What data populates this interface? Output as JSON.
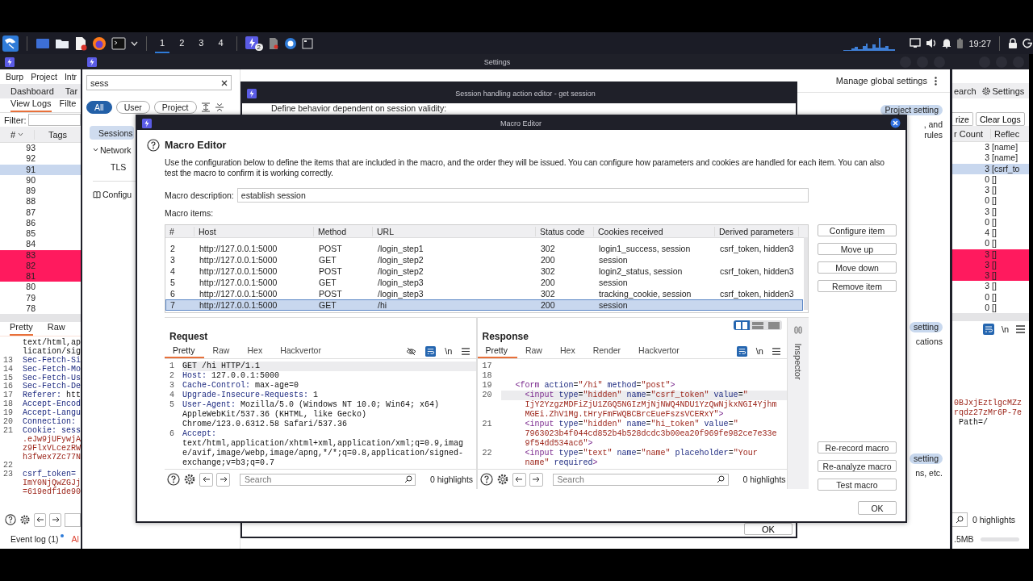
{
  "taskbar": {
    "workspaces": [
      {
        "label": "1",
        "selected": true
      },
      {
        "label": "2",
        "selected": false
      },
      {
        "label": "3",
        "selected": false
      },
      {
        "label": "4",
        "selected": false
      }
    ],
    "app_badge": "2",
    "clock": "19:27"
  },
  "burp_window": {
    "menu": [
      "Burp",
      "Project",
      "Intr"
    ],
    "tabs": [
      "Dashboard",
      "Tar"
    ],
    "subtabs": [
      {
        "label": "View Logs",
        "selected": true
      },
      {
        "label": "Filte",
        "selected": false
      }
    ],
    "filter_label": "Filter:",
    "columns": [
      "#",
      "Tags",
      "r Count",
      "Reflec"
    ],
    "rows": [
      {
        "num": "93",
        "count": "3",
        "reflected": "[name]",
        "selected": false,
        "highlighted": false
      },
      {
        "num": "92",
        "count": "3",
        "reflected": "[name]",
        "selected": false,
        "highlighted": false
      },
      {
        "num": "91",
        "count": "3",
        "reflected": "[csrf_to",
        "selected": true,
        "highlighted": false
      },
      {
        "num": "90",
        "count": "0",
        "reflected": "[]",
        "selected": false,
        "highlighted": false
      },
      {
        "num": "89",
        "count": "3",
        "reflected": "[]",
        "selected": false,
        "highlighted": false
      },
      {
        "num": "88",
        "count": "0",
        "reflected": "[]",
        "selected": false,
        "highlighted": false
      },
      {
        "num": "87",
        "count": "3",
        "reflected": "[]",
        "selected": false,
        "highlighted": false
      },
      {
        "num": "86",
        "count": "0",
        "reflected": "[]",
        "selected": false,
        "highlighted": false
      },
      {
        "num": "85",
        "count": "4",
        "reflected": "[]",
        "selected": false,
        "highlighted": false
      },
      {
        "num": "84",
        "count": "0",
        "reflected": "[]",
        "selected": false,
        "highlighted": false
      },
      {
        "num": "83",
        "count": "3",
        "reflected": "[]",
        "selected": false,
        "highlighted": true
      },
      {
        "num": "82",
        "count": "3",
        "reflected": "[]",
        "selected": false,
        "highlighted": true
      },
      {
        "num": "81",
        "count": "3",
        "reflected": "[]",
        "selected": false,
        "highlighted": true
      },
      {
        "num": "80",
        "count": "3",
        "reflected": "[]",
        "selected": false,
        "highlighted": false
      },
      {
        "num": "79",
        "count": "0",
        "reflected": "[]",
        "selected": false,
        "highlighted": false
      },
      {
        "num": "78",
        "count": "0",
        "reflected": "[]",
        "selected": false,
        "highlighted": false
      }
    ],
    "toolbar": [
      "earch",
      "Settings"
    ],
    "buttons": [
      "rize",
      "Clear Logs"
    ],
    "editor_tabs": [
      {
        "label": "Pretty",
        "selected": true
      },
      {
        "label": "Raw",
        "selected": false
      }
    ],
    "editor_lines": [
      {
        "parts": [
          {
            "kind": "text",
            "text": "text/html,ap"
          }
        ]
      },
      {
        "parts": [
          {
            "kind": "text",
            "text": "lication/sig"
          }
        ]
      },
      {
        "n": "13",
        "parts": [
          {
            "kind": "key",
            "text": "Sec-Fetch-Si"
          }
        ]
      },
      {
        "n": "14",
        "parts": [
          {
            "kind": "key",
            "text": "Sec-Fetch-Mo"
          }
        ]
      },
      {
        "n": "15",
        "parts": [
          {
            "kind": "key",
            "text": "Sec-Fetch-Us"
          }
        ]
      },
      {
        "n": "16",
        "parts": [
          {
            "kind": "key",
            "text": "Sec-Fetch-De"
          }
        ]
      },
      {
        "n": "17",
        "parts": [
          {
            "kind": "key",
            "text": "Referer:"
          },
          {
            "kind": "text",
            "text": " htt"
          }
        ]
      },
      {
        "n": "18",
        "parts": [
          {
            "kind": "key",
            "text": "Accept-Encod"
          }
        ]
      },
      {
        "n": "19",
        "parts": [
          {
            "kind": "key",
            "text": "Accept-Langu"
          }
        ]
      },
      {
        "n": "20",
        "parts": [
          {
            "kind": "key",
            "text": "Connection:"
          }
        ]
      },
      {
        "n": "21",
        "parts": [
          {
            "kind": "key",
            "text": "Cookie: sess"
          }
        ]
      },
      {
        "parts": [
          {
            "kind": "str",
            "text": ".eJw9jUFywjA"
          }
        ]
      },
      {
        "parts": [
          {
            "kind": "str",
            "text": "z9FlxVLcezRW"
          }
        ]
      },
      {
        "parts": [
          {
            "kind": "str",
            "text": "h3fwex7Zc77N"
          }
        ]
      },
      {
        "n": "22"
      },
      {
        "n": "23",
        "parts": [
          {
            "kind": "key",
            "text": "csrf_token="
          }
        ]
      },
      {
        "parts": [
          {
            "kind": "str",
            "text": "ImY0NjQwZGJj"
          }
        ]
      },
      {
        "parts": [
          {
            "kind": "str",
            "text": "=619edf1de90"
          }
        ]
      }
    ],
    "right_lines": [
      {
        "parts": [
          {
            "kind": "str",
            "text": "0BJxjEztlgcMZz"
          }
        ]
      },
      {
        "parts": [
          {
            "kind": "str",
            "text": "rqdz27zMr6P-7e"
          }
        ]
      },
      {
        "parts": [
          {
            "kind": "text",
            "text": " Path=/"
          }
        ]
      }
    ],
    "wrap_label": "\\n",
    "highlights": "0 highlights",
    "event_log": "Event log (1)",
    "alerts": "Al",
    "memory": ".5MB"
  },
  "settings_window": {
    "title": "Settings",
    "search": "sess",
    "scopes": [
      {
        "label": "All",
        "selected": true
      },
      {
        "label": "User",
        "selected": false
      },
      {
        "label": "Project",
        "selected": false
      }
    ],
    "nav": [
      {
        "label": "Sessions",
        "selected": true
      },
      {
        "label": "Network",
        "selected": false,
        "expanded": true,
        "children": [
          {
            "label": "TLS",
            "selected": false
          }
        ]
      }
    ],
    "config_link": "Configu",
    "manage": "Manage global settings",
    "fragments": [
      {
        "badge": "Project setting",
        "lines": [
          ", and",
          "rules"
        ]
      },
      {
        "badge": "setting",
        "lines": [
          "cations"
        ]
      },
      {
        "badge": "setting",
        "lines": [
          "ns, etc."
        ]
      }
    ]
  },
  "session_window": {
    "title": "Session handling action editor - get session",
    "text": "Define behavior dependent on session validity:",
    "ok": "OK"
  },
  "macro_editor": {
    "window_title": "Macro Editor",
    "heading": "Macro Editor",
    "description": "Use the configuration below to define the items that are included in the macro, and the order they will be issued. You can configure how parameters and cookies are handled for each item. You can also test the macro to confirm it is working correctly.",
    "description_label": "Macro description:",
    "description_value": "establish session",
    "items_label": "Macro items:",
    "columns": [
      "#",
      "Host",
      "Method",
      "URL",
      "Status code",
      "Cookies received",
      "Derived parameters"
    ],
    "rows": [
      {
        "num": "2",
        "host": "http://127.0.0.1:5000",
        "method": "POST",
        "url": "/login_step1",
        "status": "302",
        "cookies": "login1_success, session",
        "derived": "csrf_token, hidden3",
        "selected": false
      },
      {
        "num": "3",
        "host": "http://127.0.0.1:5000",
        "method": "GET",
        "url": "/login_step2",
        "status": "200",
        "cookies": "session",
        "selected": false
      },
      {
        "num": "4",
        "host": "http://127.0.0.1:5000",
        "method": "POST",
        "url": "/login_step2",
        "status": "302",
        "cookies": "login2_status, session",
        "derived": "csrf_token, hidden3",
        "selected": false
      },
      {
        "num": "5",
        "host": "http://127.0.0.1:5000",
        "method": "GET",
        "url": "/login_step3",
        "status": "200",
        "cookies": "session",
        "selected": false
      },
      {
        "num": "6",
        "host": "http://127.0.0.1:5000",
        "method": "POST",
        "url": "/login_step3",
        "status": "302",
        "cookies": "tracking_cookie, session",
        "derived": "csrf_token, hidden3",
        "selected": false
      },
      {
        "num": "7",
        "host": "http://127.0.0.1:5000",
        "method": "GET",
        "url": "/hi",
        "status": "200",
        "cookies": "session",
        "selected": true
      }
    ],
    "item_buttons": [
      "Configure item",
      "Move up",
      "Move down",
      "Remove item"
    ],
    "macro_buttons": [
      "Re-record macro",
      "Re-analyze macro",
      "Test macro"
    ],
    "ok": "OK",
    "inspector": "Inspector",
    "request": {
      "title": "Request",
      "tabs": [
        {
          "label": "Pretty",
          "selected": true
        },
        {
          "label": "Raw",
          "selected": false
        },
        {
          "label": "Hex",
          "selected": false
        },
        {
          "label": "Hackvertor",
          "selected": false
        }
      ],
      "wrap_label": "\\n",
      "search_placeholder": "Search",
      "highlights": "0 highlights",
      "lines": [
        {
          "n": "1",
          "current": true,
          "parts": [
            {
              "kind": "text",
              "text": "GET /hi HTTP/1.1"
            }
          ]
        },
        {
          "n": "2",
          "current": false,
          "parts": [
            {
              "kind": "key",
              "text": "Host:"
            },
            {
              "kind": "text",
              "text": " 127.0.0.1:5000"
            }
          ]
        },
        {
          "n": "3",
          "current": false,
          "parts": [
            {
              "kind": "key",
              "text": "Cache-Control:"
            },
            {
              "kind": "text",
              "text": " max-age=0"
            }
          ]
        },
        {
          "n": "4",
          "current": false,
          "parts": [
            {
              "kind": "key",
              "text": "Upgrade-Insecure-Requests:"
            },
            {
              "kind": "text",
              "text": " 1"
            }
          ]
        },
        {
          "n": "5",
          "current": false,
          "parts": [
            {
              "kind": "key",
              "text": "User-Agent:"
            },
            {
              "kind": "text",
              "text": " Mozilla/5.0 (Windows NT 10.0; Win64; x64)"
            }
          ]
        },
        {
          "current": false,
          "parts": [
            {
              "kind": "text",
              "text": "AppleWebKit/537.36 (KHTML, like Gecko)"
            }
          ]
        },
        {
          "current": false,
          "parts": [
            {
              "kind": "text",
              "text": "Chrome/123.0.6312.58 Safari/537.36"
            }
          ]
        },
        {
          "n": "6",
          "current": false,
          "parts": [
            {
              "kind": "key",
              "text": "Accept:"
            }
          ]
        },
        {
          "current": false,
          "parts": [
            {
              "kind": "text",
              "text": "text/html,application/xhtml+xml,application/xml;q=0.9,imag"
            }
          ]
        },
        {
          "current": false,
          "parts": [
            {
              "kind": "text",
              "text": "e/avif,image/webp,image/apng,*/*;q=0.8,application/signed-"
            }
          ]
        },
        {
          "current": false,
          "parts": [
            {
              "kind": "text",
              "text": "exchange;v=b3;q=0.7"
            }
          ]
        }
      ]
    },
    "response": {
      "title": "Response",
      "tabs": [
        {
          "label": "Pretty",
          "selected": true
        },
        {
          "label": "Raw",
          "selected": false
        },
        {
          "label": "Hex",
          "selected": false
        },
        {
          "label": "Render",
          "selected": false
        },
        {
          "label": "Hackvertor",
          "selected": false
        }
      ],
      "layouts": [
        {
          "selected": true
        },
        {
          "selected": false
        },
        {
          "selected": false
        }
      ],
      "wrap_label": "\\n",
      "search_placeholder": "Search",
      "highlights": "0 highlights",
      "lines": [
        {
          "n": "17",
          "current": false
        },
        {
          "n": "18",
          "current": false
        },
        {
          "n": "19",
          "current": false,
          "parts": [
            {
              "kind": "tag",
              "text": "   <form"
            },
            {
              "kind": "attr",
              "text": " action"
            },
            {
              "kind": "text",
              "text": "="
            },
            {
              "kind": "str",
              "text": "\"/hi\""
            },
            {
              "kind": "attr",
              "text": " method"
            },
            {
              "kind": "text",
              "text": "="
            },
            {
              "kind": "str",
              "text": "\"post\""
            },
            {
              "kind": "tag",
              "text": ">"
            }
          ]
        },
        {
          "n": "20",
          "current": true,
          "parts": [
            {
              "kind": "tag",
              "text": "     <input"
            },
            {
              "kind": "attr",
              "text": " type"
            },
            {
              "kind": "text",
              "text": "="
            },
            {
              "kind": "str",
              "text": "\"hidden\""
            },
            {
              "kind": "attr",
              "text": " name"
            },
            {
              "kind": "text",
              "text": "="
            },
            {
              "kind": "str",
              "text": "\"csrf_token\""
            },
            {
              "kind": "attr",
              "text": " value"
            },
            {
              "kind": "text",
              "text": "="
            },
            {
              "kind": "str",
              "text": "\""
            }
          ]
        },
        {
          "current": false,
          "parts": [
            {
              "kind": "str",
              "text": "     IjY2YzgzMDFiZjU1ZGQ5NGIzMjNjNWQ4NDU1YzQwNjkxNGI4Yjhm"
            }
          ]
        },
        {
          "current": false,
          "parts": [
            {
              "kind": "str",
              "text": "     MGEi.ZhV1Mg.tHryFmFWQBCBrcEueFszsVCERxY\""
            },
            {
              "kind": "tag",
              "text": ">"
            }
          ]
        },
        {
          "n": "21",
          "current": false,
          "parts": [
            {
              "kind": "tag",
              "text": "     <input"
            },
            {
              "kind": "attr",
              "text": " type"
            },
            {
              "kind": "text",
              "text": "="
            },
            {
              "kind": "str",
              "text": "\"hidden\""
            },
            {
              "kind": "attr",
              "text": " name"
            },
            {
              "kind": "text",
              "text": "="
            },
            {
              "kind": "str",
              "text": "\"hi_token\""
            },
            {
              "kind": "attr",
              "text": " value"
            },
            {
              "kind": "text",
              "text": "="
            },
            {
              "kind": "str",
              "text": "\""
            }
          ]
        },
        {
          "current": false,
          "parts": [
            {
              "kind": "str",
              "text": "     7963023b4f044cd852b4b528dcdc3b00ea20f969fe982ce7e33e"
            }
          ]
        },
        {
          "current": false,
          "parts": [
            {
              "kind": "str",
              "text": "     9f54dd534ac6\""
            },
            {
              "kind": "tag",
              "text": ">"
            }
          ]
        },
        {
          "n": "22",
          "current": false,
          "parts": [
            {
              "kind": "tag",
              "text": "     <input"
            },
            {
              "kind": "attr",
              "text": " type"
            },
            {
              "kind": "text",
              "text": "="
            },
            {
              "kind": "str",
              "text": "\"text\""
            },
            {
              "kind": "attr",
              "text": " name"
            },
            {
              "kind": "text",
              "text": "="
            },
            {
              "kind": "str",
              "text": "\"name\""
            },
            {
              "kind": "attr",
              "text": " placeholder"
            },
            {
              "kind": "text",
              "text": "="
            },
            {
              "kind": "str",
              "text": "\"Your"
            }
          ]
        },
        {
          "current": false,
          "parts": [
            {
              "kind": "str",
              "text": "     name\""
            },
            {
              "kind": "attr",
              "text": " required"
            },
            {
              "kind": "tag",
              "text": ">"
            }
          ]
        }
      ]
    }
  }
}
